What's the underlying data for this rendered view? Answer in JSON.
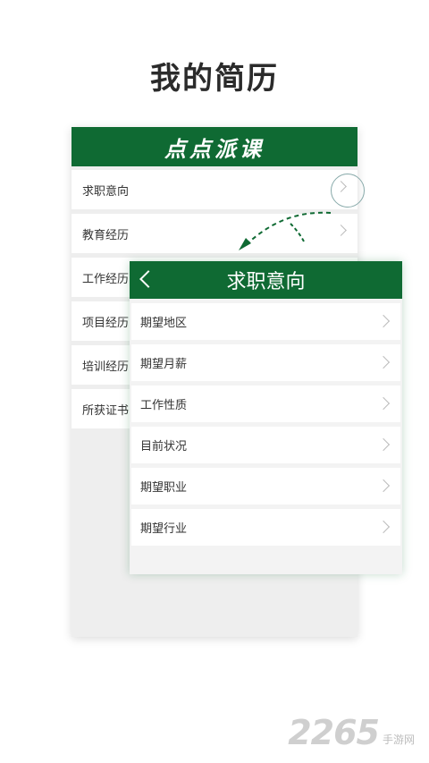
{
  "headline": "我的简历",
  "brand": "点点派课",
  "back_items": [
    {
      "label": "求职意向"
    },
    {
      "label": "教育经历"
    },
    {
      "label": "工作经历"
    },
    {
      "label": "项目经历"
    },
    {
      "label": "培训经历"
    },
    {
      "label": "所获证书"
    }
  ],
  "front": {
    "title": "求职意向",
    "items": [
      {
        "label": "期望地区"
      },
      {
        "label": "期望月薪"
      },
      {
        "label": "工作性质"
      },
      {
        "label": "目前状况"
      },
      {
        "label": "期望职业"
      },
      {
        "label": "期望行业"
      }
    ]
  },
  "watermark": {
    "number": "2265",
    "text": "手游网"
  },
  "colors": {
    "brand_green": "#0f6a33"
  }
}
